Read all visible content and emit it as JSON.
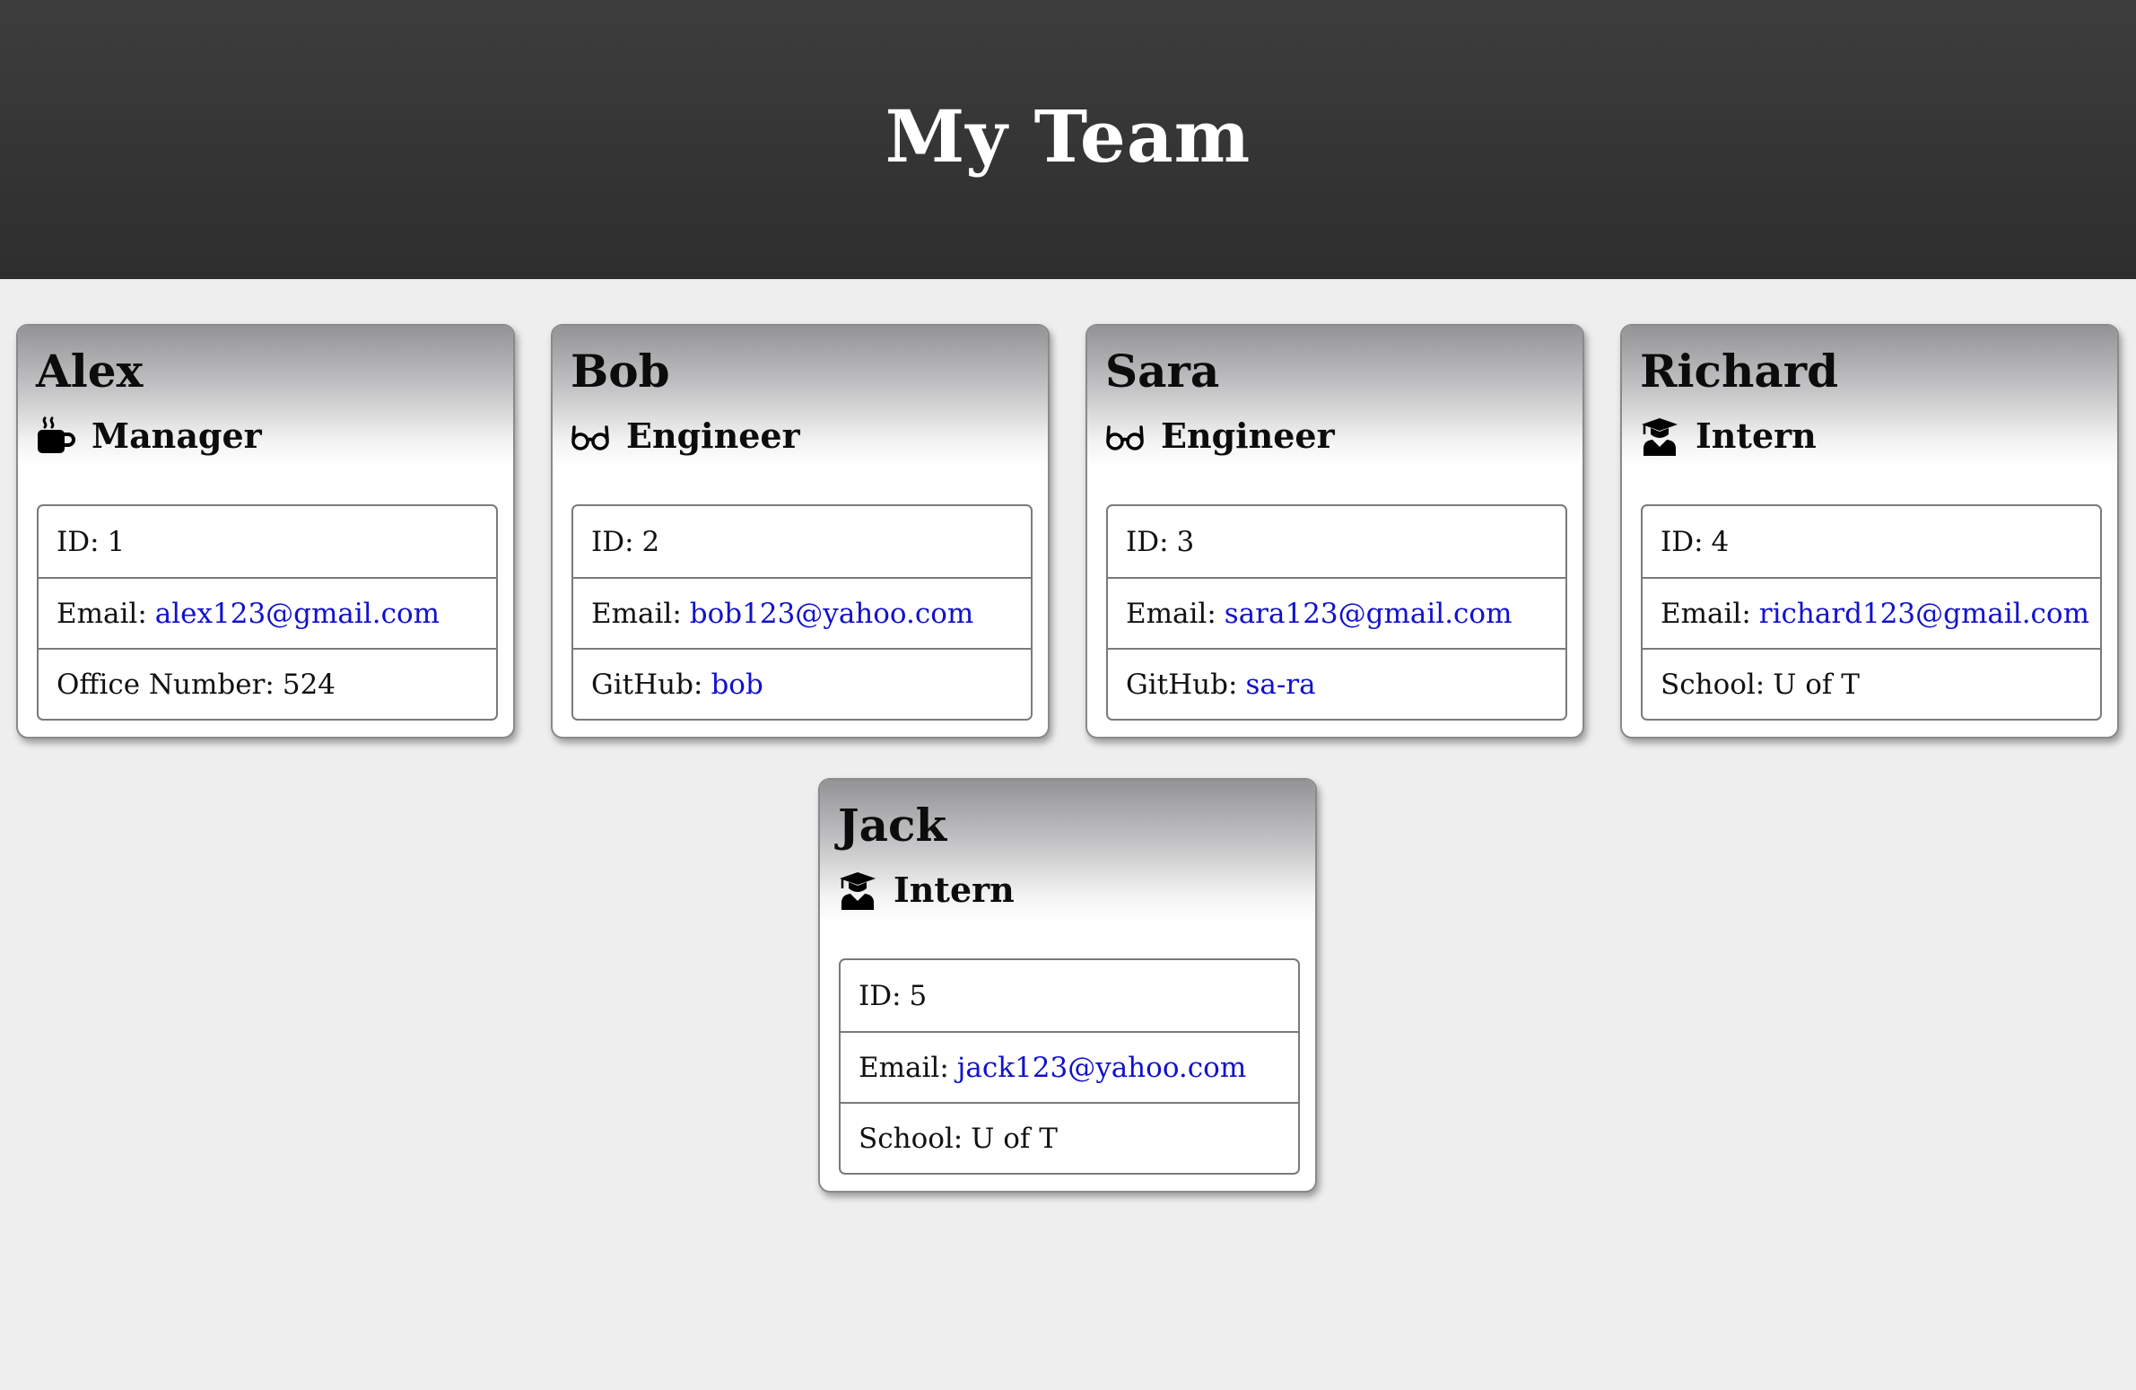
{
  "header": {
    "title": "My Team"
  },
  "colors": {
    "header_bg": "#333333",
    "page_bg": "#eeeeee",
    "link": "#1111cc"
  },
  "members": [
    {
      "name": "Alex",
      "role": "Manager",
      "role_icon": "coffee-mug-icon",
      "id_label": "ID:",
      "id_value": "1",
      "email_label": "Email:",
      "email": "alex123@gmail.com",
      "extra_label": "Office Number:",
      "extra_value": "524"
    },
    {
      "name": "Bob",
      "role": "Engineer",
      "role_icon": "glasses-icon",
      "id_label": "ID:",
      "id_value": "2",
      "email_label": "Email:",
      "email": "bob123@yahoo.com",
      "extra_label": "GitHub:",
      "extra_value": "bob"
    },
    {
      "name": "Sara",
      "role": "Engineer",
      "role_icon": "glasses-icon",
      "id_label": "ID:",
      "id_value": "3",
      "email_label": "Email:",
      "email": "sara123@gmail.com",
      "extra_label": "GitHub:",
      "extra_value": "sa-ra"
    },
    {
      "name": "Richard",
      "role": "Intern",
      "role_icon": "graduate-icon",
      "id_label": "ID:",
      "id_value": "4",
      "email_label": "Email:",
      "email": "richard123@gmail.com",
      "extra_label": "School:",
      "extra_value": "U of T"
    },
    {
      "name": "Jack",
      "role": "Intern",
      "role_icon": "graduate-icon",
      "id_label": "ID:",
      "id_value": "5",
      "email_label": "Email:",
      "email": "jack123@yahoo.com",
      "extra_label": "School:",
      "extra_value": "U of T"
    }
  ]
}
